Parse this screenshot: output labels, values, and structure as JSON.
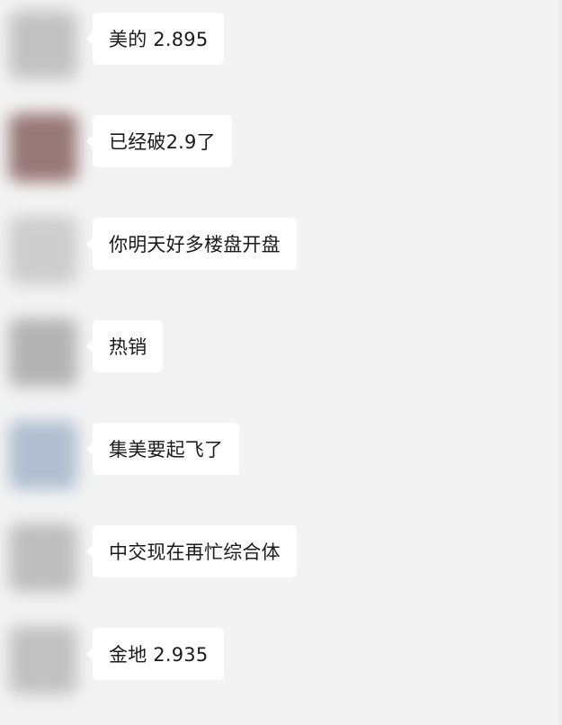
{
  "messages": [
    {
      "sender": "",
      "avatar_color": "#bdbdbd",
      "text": "美的 2.895"
    },
    {
      "sender": "",
      "avatar_color": "#8f6a6a",
      "text": "已经破2.9了"
    },
    {
      "sender": "",
      "avatar_color": "#c9c9c9",
      "text": "你明天好多楼盘开盘"
    },
    {
      "sender": "",
      "avatar_color": "#adadad",
      "text": "热销"
    },
    {
      "sender": "",
      "avatar_color": "#a9b9cc",
      "text": "集美要起飞了"
    },
    {
      "sender": "",
      "avatar_color": "#b8b8b8",
      "text": "中交现在再忙综合体"
    },
    {
      "sender": "",
      "avatar_color": "#bcbcbc",
      "text": "金地 2.935"
    }
  ]
}
